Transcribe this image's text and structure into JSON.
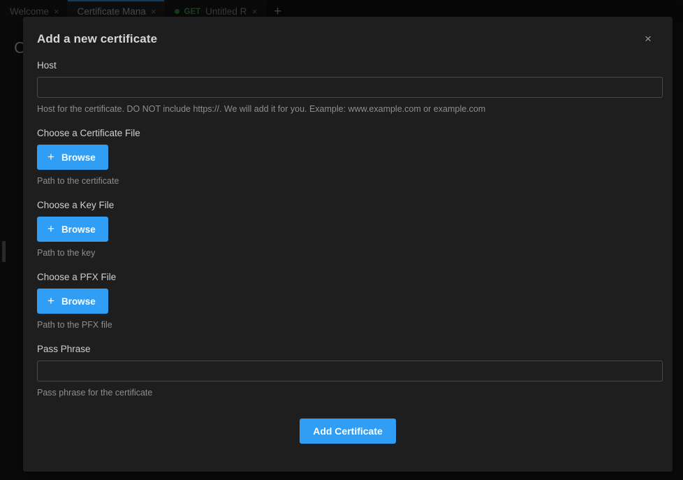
{
  "window": {
    "tabs": [
      {
        "label": "Welcome",
        "close_icon": "close-icon",
        "active": false,
        "method": "",
        "dirty": false
      },
      {
        "label": "Certificate Mana",
        "close_icon": "close-icon",
        "active": true,
        "method": "",
        "dirty": false
      },
      {
        "label": "Untitled Requ",
        "close_icon": "close-icon",
        "active": false,
        "method": "GET",
        "dirty": true
      }
    ],
    "new_tab_label": "+",
    "page_heading": "Certificates"
  },
  "modal": {
    "title": "Add a new certificate",
    "close_label": "×",
    "fields": {
      "host": {
        "label": "Host",
        "value": "",
        "placeholder": "",
        "helper": "Host for the certificate. DO NOT include https://. We will add it for you. Example: www.example.com or example.com"
      },
      "certificate_file": {
        "label": "Choose a Certificate File",
        "button_label": "Browse",
        "button_icon": "plus-icon",
        "helper": "Path to the certificate"
      },
      "key_file": {
        "label": "Choose a Key File",
        "button_label": "Browse",
        "button_icon": "plus-icon",
        "helper": "Path to the key"
      },
      "pfx_file": {
        "label": "Choose a PFX File",
        "button_label": "Browse",
        "button_icon": "plus-icon",
        "helper": "Path to the PFX file"
      },
      "pass_phrase": {
        "label": "Pass Phrase",
        "value": "",
        "placeholder": "",
        "helper": "Pass phrase for the certificate"
      }
    },
    "submit_label": "Add Certificate"
  },
  "colors": {
    "accent": "#2f9ef4",
    "modal_bg": "#1e1e1e",
    "app_bg": "#1b1b1b",
    "method_get": "#4caf50",
    "dirty_dot": "#3fa34a"
  }
}
